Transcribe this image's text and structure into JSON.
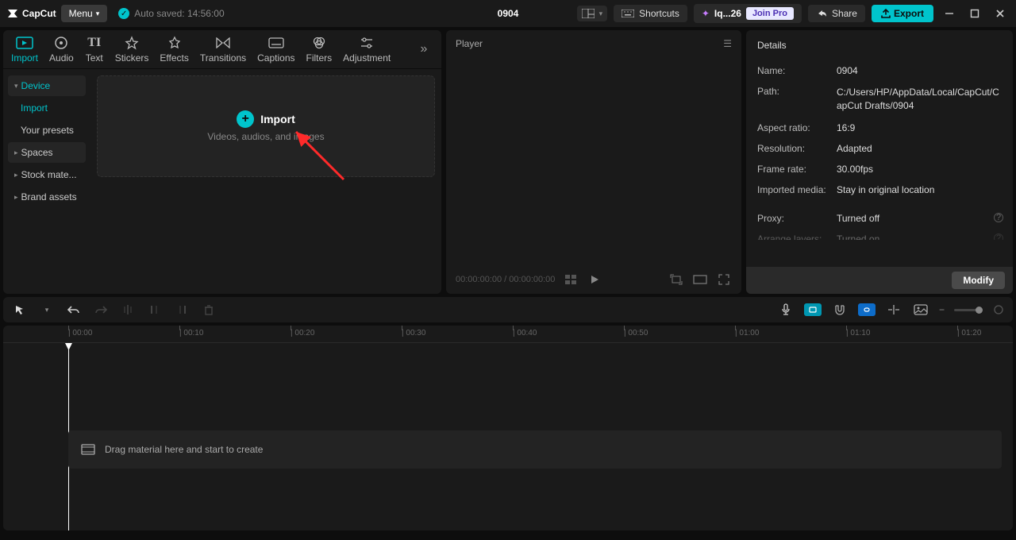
{
  "titlebar": {
    "app_name": "CapCut",
    "menu_label": "Menu",
    "autosave_label": "Auto saved: 14:56:00",
    "project_title": "0904",
    "shortcuts_label": "Shortcuts",
    "user_label": "Iq...26",
    "join_pro_label": "Join Pro",
    "share_label": "Share",
    "export_label": "Export"
  },
  "tabs": [
    {
      "key": "import",
      "label": "Import"
    },
    {
      "key": "audio",
      "label": "Audio"
    },
    {
      "key": "text",
      "label": "Text"
    },
    {
      "key": "stickers",
      "label": "Stickers"
    },
    {
      "key": "effects",
      "label": "Effects"
    },
    {
      "key": "transitions",
      "label": "Transitions"
    },
    {
      "key": "captions",
      "label": "Captions"
    },
    {
      "key": "filters",
      "label": "Filters"
    },
    {
      "key": "adjustment",
      "label": "Adjustment"
    }
  ],
  "sidebar": {
    "device": "Device",
    "import": "Import",
    "presets": "Your presets",
    "spaces": "Spaces",
    "stock": "Stock mate...",
    "brand": "Brand assets"
  },
  "import_box": {
    "label": "Import",
    "sub": "Videos, audios, and images"
  },
  "player": {
    "title": "Player",
    "time_current": "00:00:00:00",
    "time_total": "00:00:00:00"
  },
  "details": {
    "title": "Details",
    "rows": {
      "name_label": "Name:",
      "name_val": "0904",
      "path_label": "Path:",
      "path_val": "C:/Users/HP/AppData/Local/CapCut/CapCut Drafts/0904",
      "aspect_label": "Aspect ratio:",
      "aspect_val": "16:9",
      "res_label": "Resolution:",
      "res_val": "Adapted",
      "fps_label": "Frame rate:",
      "fps_val": "30.00fps",
      "media_label": "Imported media:",
      "media_val": "Stay in original location",
      "proxy_label": "Proxy:",
      "proxy_val": "Turned off",
      "arrange_label": "Arrange layers:",
      "arrange_val": "Turned on"
    },
    "modify_label": "Modify"
  },
  "timeline": {
    "drop_hint": "Drag material here and start to create",
    "marks": [
      "00:00",
      "00:10",
      "00:20",
      "00:30",
      "00:40",
      "00:50",
      "01:00",
      "01:10",
      "01:20"
    ]
  },
  "colors": {
    "accent": "#00c4cc",
    "chip1": "#00a0b8",
    "chip2": "#6a6a6a",
    "chip3": "#1e88e5"
  }
}
